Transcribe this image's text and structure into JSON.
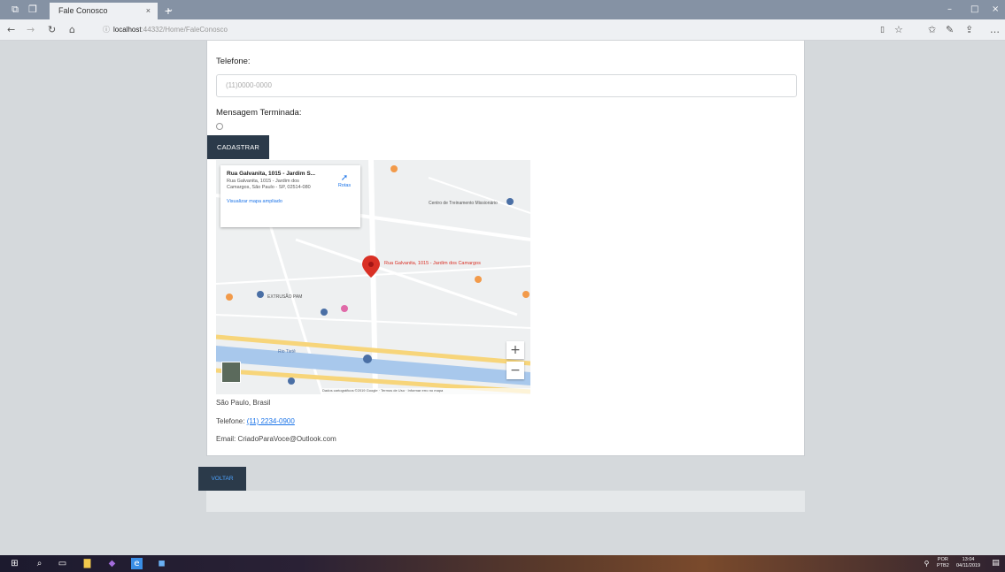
{
  "browser": {
    "tab_title": "Fale Conosco",
    "tab_close": "×",
    "new_tab": "+",
    "tab_dropdown": "⌄",
    "url_host": "localhost",
    "url_path": ":44332/Home/FaleConosco",
    "window_controls": [
      "–",
      "□",
      "×"
    ]
  },
  "form": {
    "phone_label": "Telefone:",
    "phone_placeholder": "(11)0000-0000",
    "finished_label": "Mensagem Terminada:",
    "submit_label": "CADASTRAR"
  },
  "map": {
    "place_title": "Rua Galvanita, 1015 - Jardim S...",
    "place_address": "Rua Galvanita, 1015 - Jardim dos Camargos, São Paulo - SP, 02514-080",
    "larger_map_link": "Visualizar mapa ampliado",
    "directions_label": "Rotas",
    "zoom_in": "+",
    "zoom_out": "−",
    "footer": "Dados cartográficos ©2019 Google · Termos de Uso · Informar erro no mapa",
    "labels": [
      {
        "text": "Rua Galvanita, 1015 - Jardim dos Camargos",
        "color": "#d93025"
      },
      {
        "text": "Centro de Treinamento Missionário",
        "color": "#555555"
      },
      {
        "text": "EXTRUSÃO PAM",
        "color": "#555555"
      },
      {
        "text": "Rio Tietê",
        "color": "#4a6fa5"
      }
    ]
  },
  "contact": {
    "city": "São Paulo, Brasil",
    "phone_label": "Telefone: ",
    "phone_value": "(11) 2234-0900",
    "email": "Email: CriadoParaVoce@Outlook.com"
  },
  "back_button": "VOLTAR",
  "taskbar": {
    "lang": "POR",
    "lang2": "PTB2",
    "time": "13:04",
    "date": "04/11/2019"
  },
  "colors": {
    "button_bg": "#2b3a4a",
    "link": "#1a73e8",
    "pin": "#d93025",
    "water": "#a8c8ec",
    "road_yellow": "#f7d57a"
  }
}
